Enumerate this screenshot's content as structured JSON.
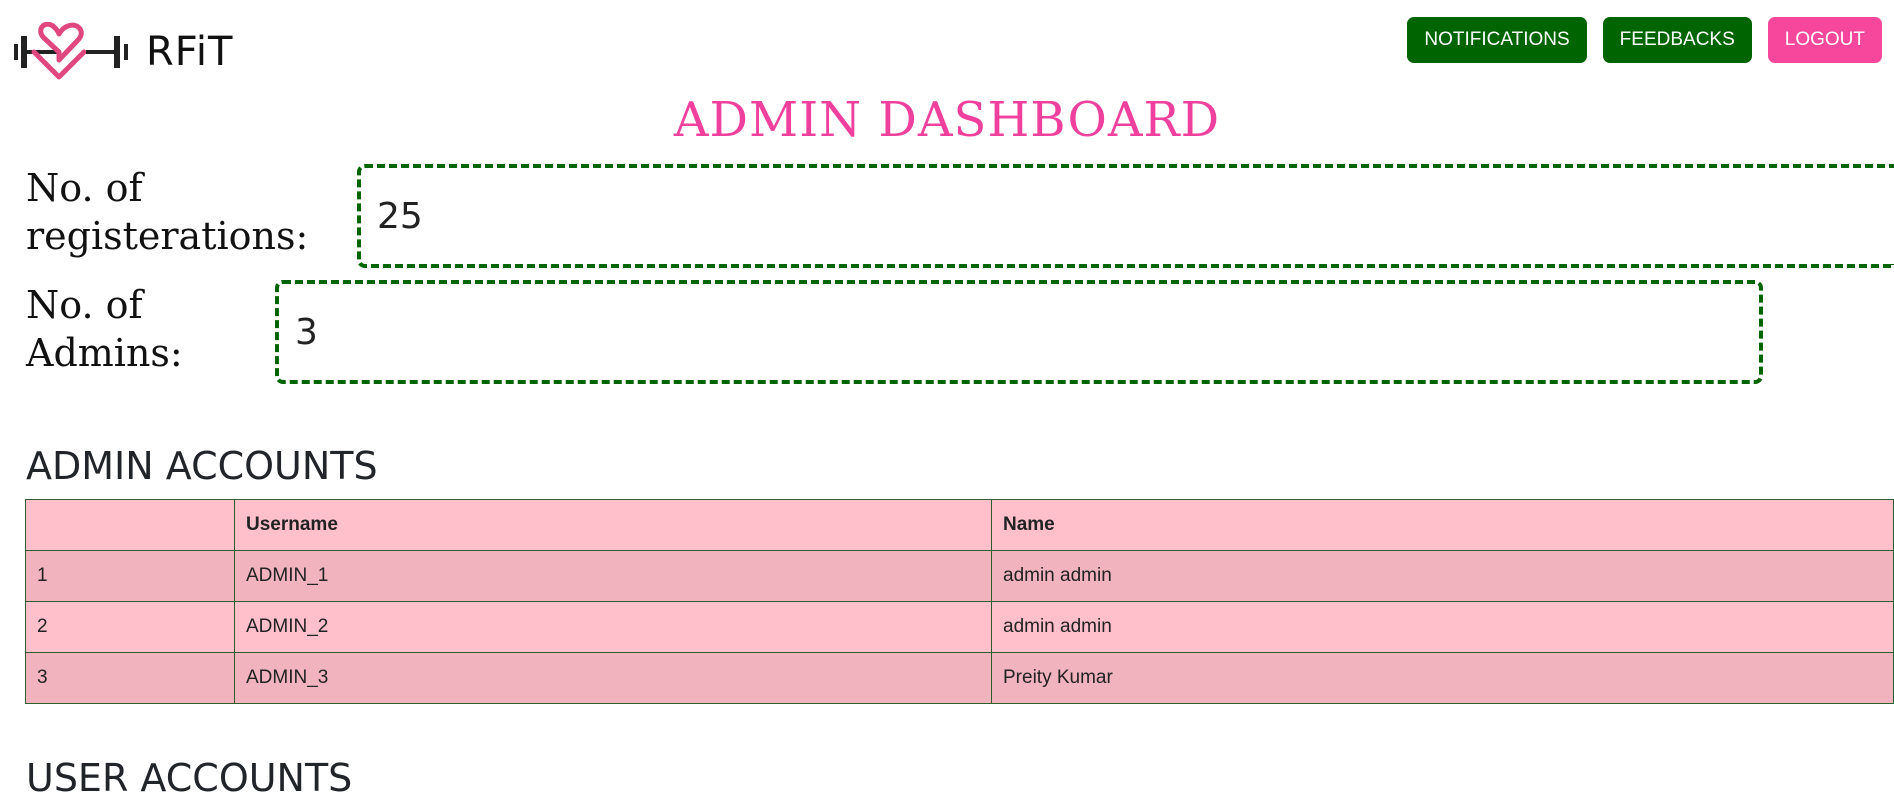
{
  "header": {
    "brand_name": "RFiT",
    "logo_icon": "heart-dumbbell-icon",
    "buttons": {
      "notifications": "NOTIFICATIONS",
      "feedbacks": "FEEDBACKS",
      "logout": "LOGOUT"
    }
  },
  "page_title": "ADMIN DASHBOARD",
  "stats": {
    "registrations": {
      "label_line1": "No. of",
      "label_line2": "registerations:",
      "value": "25"
    },
    "admins": {
      "label_line1": "No. of",
      "label_line2": "Admins:",
      "value": "3"
    }
  },
  "admin_accounts": {
    "heading": "ADMIN ACCOUNTS",
    "columns": [
      "",
      "Username",
      "Name"
    ],
    "rows": [
      {
        "index": "1",
        "username": "ADMIN_1",
        "name": "admin admin"
      },
      {
        "index": "2",
        "username": "ADMIN_2",
        "name": "admin admin"
      },
      {
        "index": "3",
        "username": "ADMIN_3",
        "name": "Preity Kumar"
      }
    ]
  },
  "user_accounts": {
    "heading": "USER ACCOUNTS"
  },
  "colors": {
    "primary_green": "#006400",
    "accent_pink": "#f0409d",
    "logout_pink": "#f7479d",
    "table_pink": "#ffc0cb",
    "table_pink_striped": "#f1b4bf"
  }
}
